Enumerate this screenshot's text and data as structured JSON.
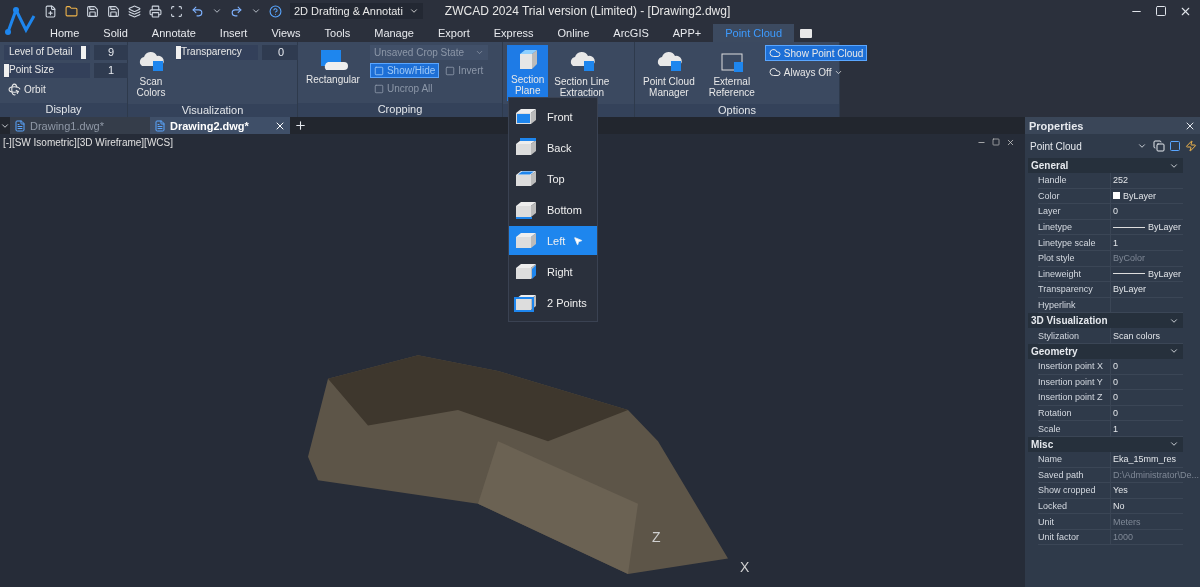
{
  "window": {
    "title": "ZWCAD 2024 Trial version (Limited) - [Drawing2.dwg]",
    "workspace": "2D Drafting & Annotati"
  },
  "ribbon_tabs": [
    {
      "label": "Home",
      "selected": false
    },
    {
      "label": "Solid",
      "selected": false
    },
    {
      "label": "Annotate",
      "selected": false
    },
    {
      "label": "Insert",
      "selected": false
    },
    {
      "label": "Views",
      "selected": false
    },
    {
      "label": "Tools",
      "selected": false
    },
    {
      "label": "Manage",
      "selected": false
    },
    {
      "label": "Export",
      "selected": false
    },
    {
      "label": "Express",
      "selected": false
    },
    {
      "label": "Online",
      "selected": false
    },
    {
      "label": "ArcGIS",
      "selected": false
    },
    {
      "label": "APP+",
      "selected": false
    },
    {
      "label": "Point Cloud",
      "selected": true
    }
  ],
  "display": {
    "title": "Display",
    "sliders": [
      {
        "label": "Level of Detail",
        "value": "9",
        "level": 0.95
      },
      {
        "label": "Point Size",
        "value": "1",
        "level": 0
      }
    ],
    "orbit": "Orbit"
  },
  "visualization": {
    "title": "Visualization",
    "scan_colors": "Scan\nColors",
    "transparency": {
      "label": "Transparency",
      "value": "0",
      "level": 0
    }
  },
  "cropping": {
    "title": "Cropping",
    "rectangular": "Rectangular",
    "crop_state": {
      "value": "Unsaved Crop State",
      "disabled": true
    },
    "buttons": [
      {
        "label": "Show/Hide",
        "on": true,
        "disabled": true
      },
      {
        "label": "Invert",
        "on": false,
        "disabled": true
      },
      {
        "label": "Uncrop All",
        "on": false,
        "disabled": true
      }
    ]
  },
  "section": {
    "buttons": [
      {
        "label": "Section\nPlane",
        "on": true
      },
      {
        "label": "Section Line\nExtraction",
        "on": false
      }
    ]
  },
  "section_menu": [
    {
      "label": "Front",
      "selected": false
    },
    {
      "label": "Back",
      "selected": false
    },
    {
      "label": "Top",
      "selected": false
    },
    {
      "label": "Bottom",
      "selected": false
    },
    {
      "label": "Left",
      "selected": true
    },
    {
      "label": "Right",
      "selected": false
    },
    {
      "label": "2 Points",
      "selected": false
    }
  ],
  "options": {
    "title": "Options",
    "buttons": [
      {
        "label": "Point Cloud\nManager"
      },
      {
        "label": "External\nReference"
      }
    ],
    "show_point_cloud": {
      "label": "Show Point Cloud",
      "on": true
    },
    "always_off": "Always Off"
  },
  "doc_tabs": [
    {
      "label": "Drawing1.dwg*",
      "selected": false
    },
    {
      "label": "Drawing2.dwg*",
      "selected": true
    }
  ],
  "viewport": {
    "label": "[-][SW Isometric][3D Wireframe][WCS]",
    "axis_z": "Z",
    "axis_x": "X"
  },
  "properties": {
    "title": "Properties",
    "object": "Point Cloud",
    "sections": [
      {
        "title": "General",
        "rows": [
          {
            "name": "Handle",
            "value": "252",
            "kind": "text",
            "disabled": false
          },
          {
            "name": "Color",
            "value": "ByLayer",
            "kind": "color",
            "disabled": false
          },
          {
            "name": "Layer",
            "value": "0",
            "kind": "text",
            "disabled": false
          },
          {
            "name": "Linetype",
            "value": "ByLayer",
            "kind": "line",
            "disabled": false
          },
          {
            "name": "Linetype scale",
            "value": "1",
            "kind": "text",
            "disabled": false
          },
          {
            "name": "Plot style",
            "value": "ByColor",
            "kind": "text",
            "disabled": true
          },
          {
            "name": "Lineweight",
            "value": "ByLayer",
            "kind": "line",
            "disabled": false
          },
          {
            "name": "Transparency",
            "value": "ByLayer",
            "kind": "text",
            "disabled": false
          },
          {
            "name": "Hyperlink",
            "kind": "text"
          }
        ]
      },
      {
        "title": "3D Visualization",
        "rows": [
          {
            "name": "Stylization",
            "value": "Scan colors",
            "kind": "text",
            "disabled": false
          }
        ]
      },
      {
        "title": "Geometry",
        "rows": [
          {
            "name": "Insertion point X",
            "value": "0",
            "kind": "text",
            "disabled": false
          },
          {
            "name": "Insertion point Y",
            "value": "0",
            "kind": "text",
            "disabled": false
          },
          {
            "name": "Insertion point Z",
            "value": "0",
            "kind": "text",
            "disabled": false
          },
          {
            "name": "Rotation",
            "value": "0",
            "kind": "text",
            "disabled": false
          },
          {
            "name": "Scale",
            "value": "1",
            "kind": "text",
            "disabled": false
          }
        ]
      },
      {
        "title": "Misc",
        "rows": [
          {
            "name": "Name",
            "value": "Eka_15mm_res",
            "kind": "text",
            "disabled": false
          },
          {
            "name": "Saved path",
            "value": "D:\\Administrator\\De...",
            "kind": "text",
            "disabled": true
          },
          {
            "name": "Show cropped",
            "value": "Yes",
            "kind": "text",
            "disabled": false
          },
          {
            "name": "Locked",
            "value": "No",
            "kind": "text",
            "disabled": false
          },
          {
            "name": "Unit",
            "value": "Meters",
            "kind": "text",
            "disabled": true
          },
          {
            "name": "Unit factor",
            "value": "1000",
            "kind": "text",
            "disabled": true
          }
        ]
      }
    ]
  }
}
